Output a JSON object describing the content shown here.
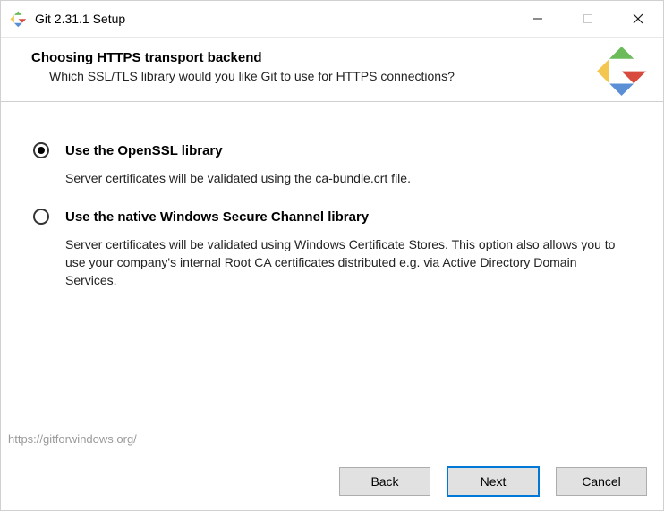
{
  "window": {
    "title": "Git 2.31.1 Setup"
  },
  "header": {
    "title": "Choosing HTTPS transport backend",
    "subtitle": "Which SSL/TLS library would you like Git to use for HTTPS connections?"
  },
  "options": [
    {
      "label": "Use the OpenSSL library",
      "desc": "Server certificates will be validated using the ca-bundle.crt file.",
      "selected": true
    },
    {
      "label": "Use the native Windows Secure Channel library",
      "desc": "Server certificates will be validated using Windows Certificate Stores.\nThis option also allows you to use your company's internal Root CA certificates distributed e.g. via Active Directory Domain Services.",
      "selected": false
    }
  ],
  "footer": {
    "url_text": "https://gitforwindows.org/"
  },
  "buttons": {
    "back": "Back",
    "next": "Next",
    "cancel": "Cancel"
  }
}
